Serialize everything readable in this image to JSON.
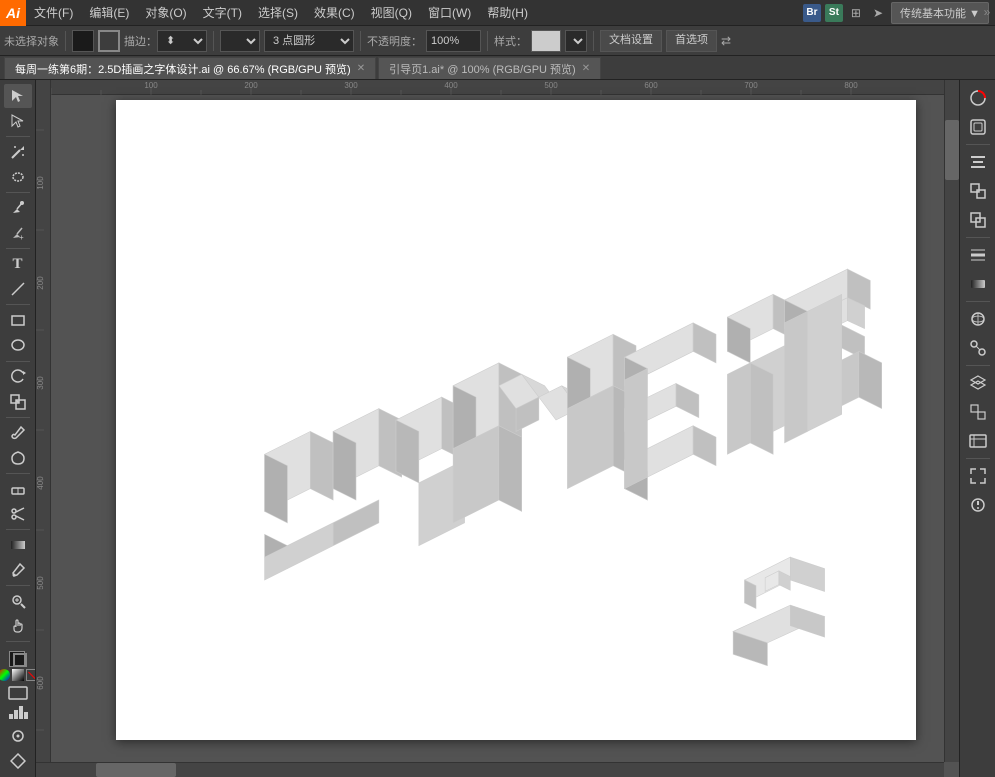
{
  "app": {
    "logo": "Ai",
    "title": "Adobe Illustrator"
  },
  "menu": {
    "items": [
      {
        "label": "文件(F)"
      },
      {
        "label": "编辑(E)"
      },
      {
        "label": "对象(O)"
      },
      {
        "label": "文字(T)"
      },
      {
        "label": "选择(S)"
      },
      {
        "label": "效果(C)"
      },
      {
        "label": "视图(Q)"
      },
      {
        "label": "窗口(W)"
      },
      {
        "label": "帮助(H)"
      }
    ],
    "top_right": "传统基本功能 ▼"
  },
  "toolbar": {
    "object_label": "未选择对象",
    "stroke_label": "描边：",
    "point_select": "3 点圆形",
    "opacity_label": "不透明度：",
    "opacity_value": "100%",
    "style_label": "样式：",
    "doc_settings": "文档设置",
    "preferences": "首选项"
  },
  "tabs": [
    {
      "label": "每周一练第6期：2.5D插画之字体设计.ai @ 66.67% (RGB/GPU 预览)",
      "active": true
    },
    {
      "label": "引导页1.ai* @ 100% (RGB/GPU 预览)",
      "active": false
    }
  ],
  "tools": {
    "left": [
      {
        "name": "selection",
        "icon": "↖",
        "active": true
      },
      {
        "name": "direct-selection",
        "icon": "↗"
      },
      {
        "name": "magic-wand",
        "icon": "✦"
      },
      {
        "name": "lasso",
        "icon": "⌖"
      },
      {
        "name": "pen",
        "icon": "✒"
      },
      {
        "name": "type",
        "icon": "T"
      },
      {
        "name": "line",
        "icon": "╲"
      },
      {
        "name": "rectangle",
        "icon": "□"
      },
      {
        "name": "rotate",
        "icon": "↻"
      },
      {
        "name": "scale",
        "icon": "⤡"
      },
      {
        "name": "paintbrush",
        "icon": "🖌"
      },
      {
        "name": "blob-brush",
        "icon": "✏"
      },
      {
        "name": "eraser",
        "icon": "◻"
      },
      {
        "name": "scissors",
        "icon": "✂"
      },
      {
        "name": "gradient",
        "icon": "■"
      },
      {
        "name": "eyedropper",
        "icon": "✦"
      },
      {
        "name": "zoom",
        "icon": "⌕"
      },
      {
        "name": "hand",
        "icon": "✋"
      }
    ],
    "right": [
      {
        "name": "color-fill",
        "icon": "◉"
      },
      {
        "name": "stroke",
        "icon": "◎"
      },
      {
        "name": "none",
        "icon": "⊘"
      },
      {
        "name": "color-mode",
        "icon": "▣"
      },
      {
        "name": "gradient-mode",
        "icon": "▤"
      },
      {
        "name": "pattern-mode",
        "icon": "▩"
      },
      {
        "name": "align",
        "icon": "≡"
      },
      {
        "name": "transform",
        "icon": "⊞"
      },
      {
        "name": "pathfinder",
        "icon": "✦"
      },
      {
        "name": "rotate3d",
        "icon": "⊙"
      },
      {
        "name": "layers",
        "icon": "▪"
      },
      {
        "name": "artboards",
        "icon": "⊡"
      },
      {
        "name": "links",
        "icon": "⊟"
      }
    ]
  },
  "canvas": {
    "zoom": "66.67%",
    "color_mode": "RGB/GPU 预览"
  }
}
